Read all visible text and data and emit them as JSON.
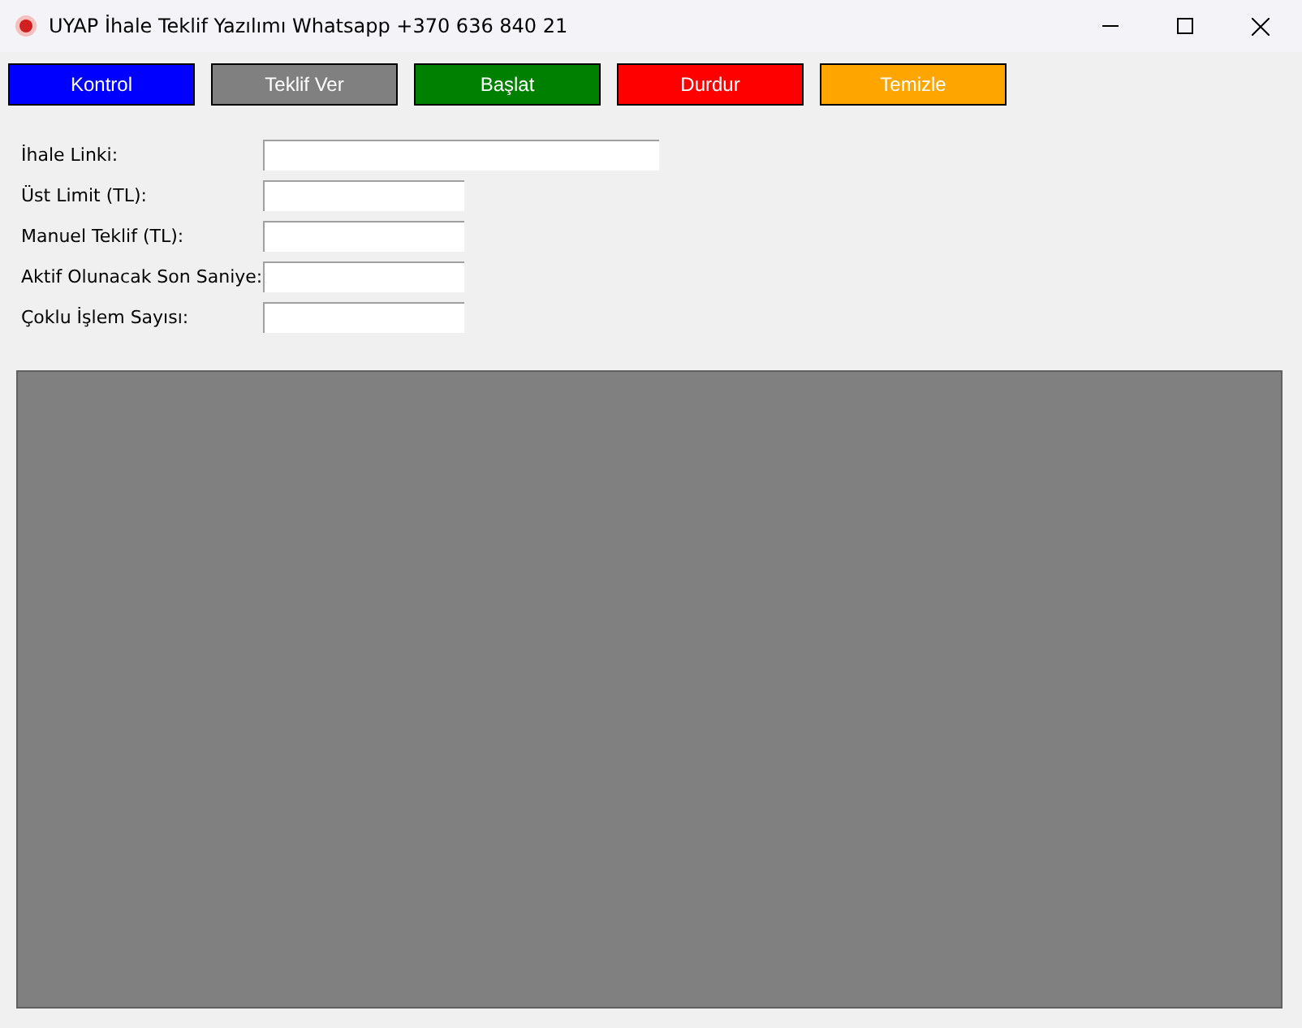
{
  "window": {
    "title": "UYAP İhale Teklif Yazılımı Whatsapp +370 636 840 21"
  },
  "buttons": [
    {
      "label": "Kontrol",
      "color": "#0000ff"
    },
    {
      "label": "Teklif Ver",
      "color": "#808080"
    },
    {
      "label": "Başlat",
      "color": "#008000"
    },
    {
      "label": "Durdur",
      "color": "#ff0000"
    },
    {
      "label": "Temizle",
      "color": "#ffa500"
    }
  ],
  "fields": [
    {
      "label": "İhale Linki:",
      "kind": "long"
    },
    {
      "label": "Üst Limit (TL):",
      "kind": "short"
    },
    {
      "label": "Manuel Teklif (TL):",
      "kind": "short"
    },
    {
      "label": "Aktif Olunacak Son Saniye:",
      "kind": "short"
    },
    {
      "label": "Çoklu İşlem Sayısı:",
      "kind": "short"
    }
  ]
}
